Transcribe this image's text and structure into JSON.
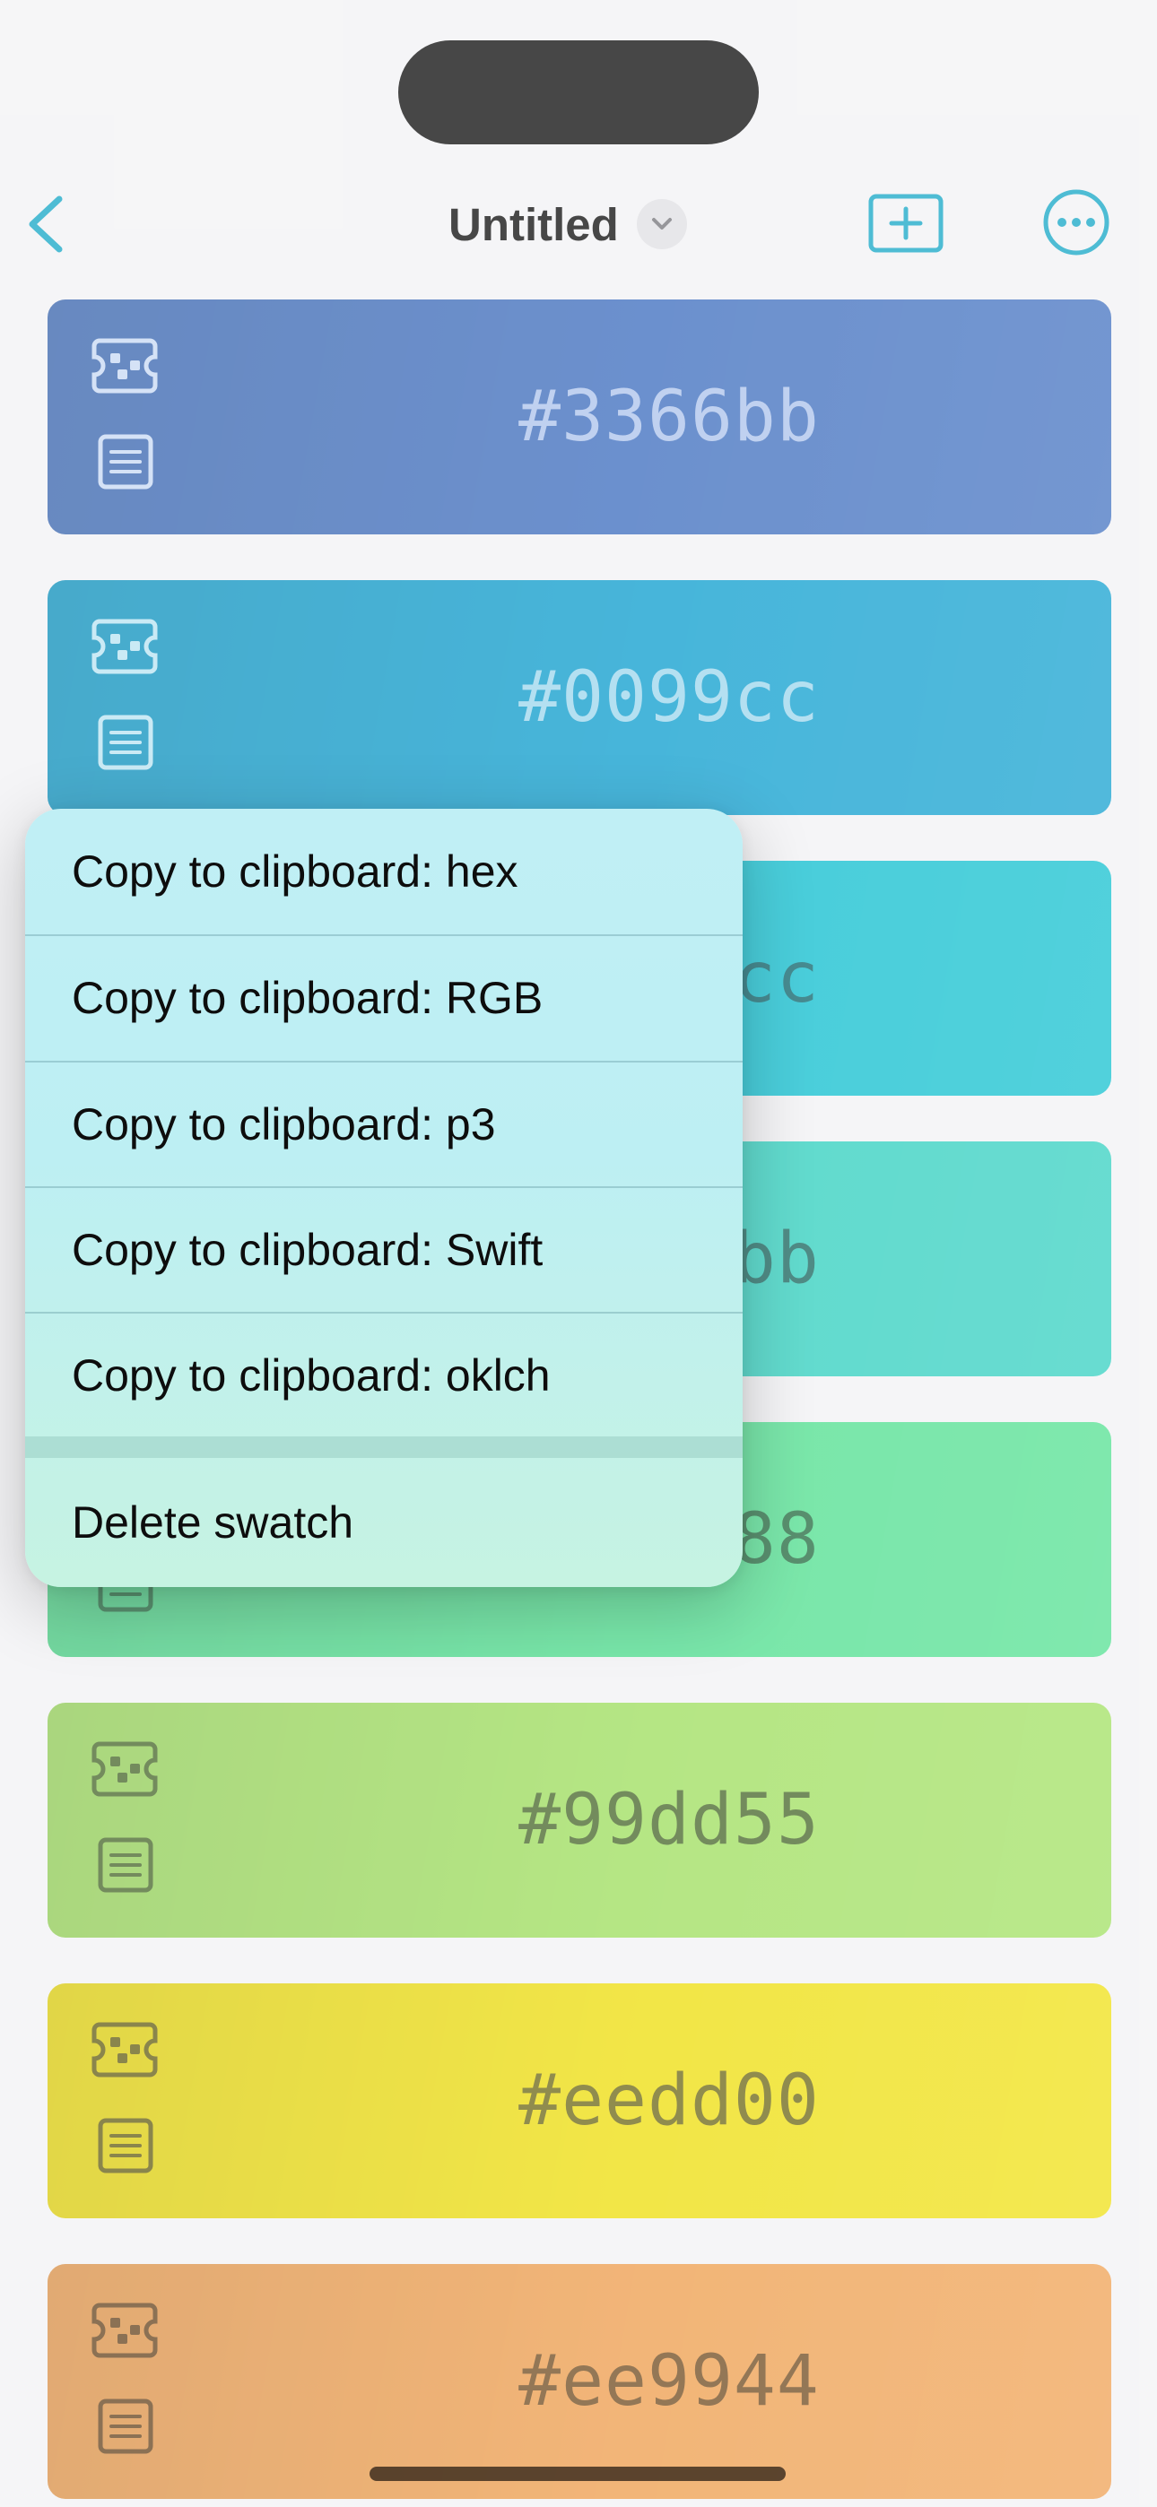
{
  "nav": {
    "title": "Untitled"
  },
  "swatches": [
    {
      "hex": "#3366bb",
      "color": "#3366bb",
      "text_color": "#a8c0ea",
      "icon_color": "#c5d7f3"
    },
    {
      "hex": "#0099cc",
      "color": "#0099cc",
      "text_color": "#98d4ec",
      "icon_color": "#b6e2f2"
    },
    {
      "hex": "#00bbcc",
      "color": "#00bbcc",
      "text_color": "#005f67",
      "icon_color": "#005f67"
    },
    {
      "hex": "#22ccbb",
      "color": "#22ccbb",
      "text_color": "#0d6058",
      "icon_color": "#0d6058"
    },
    {
      "hex": "#44dd88",
      "color": "#44dd88",
      "text_color": "#1a6638",
      "icon_color": "#1a6638"
    },
    {
      "hex": "#99dd55",
      "color": "#99dd55",
      "text_color": "#3d5f1f",
      "icon_color": "#3d5f1f"
    },
    {
      "hex": "#eedd00",
      "color": "#eedd00",
      "text_color": "#66600a",
      "icon_color": "#5e5708"
    },
    {
      "hex": "#ee9944",
      "color": "#ee9944",
      "text_color": "#6a4316",
      "icon_color": "#5f3b13"
    }
  ],
  "context_menu": {
    "items": [
      "Copy to clipboard: hex",
      "Copy to clipboard: RGB",
      "Copy to clipboard: p3",
      "Copy to clipboard: Swift",
      "Copy to clipboard: oklch"
    ],
    "delete_label": "Delete swatch"
  },
  "colors": {
    "accent": "#0aa2c4",
    "background": "#f2f2f4"
  }
}
